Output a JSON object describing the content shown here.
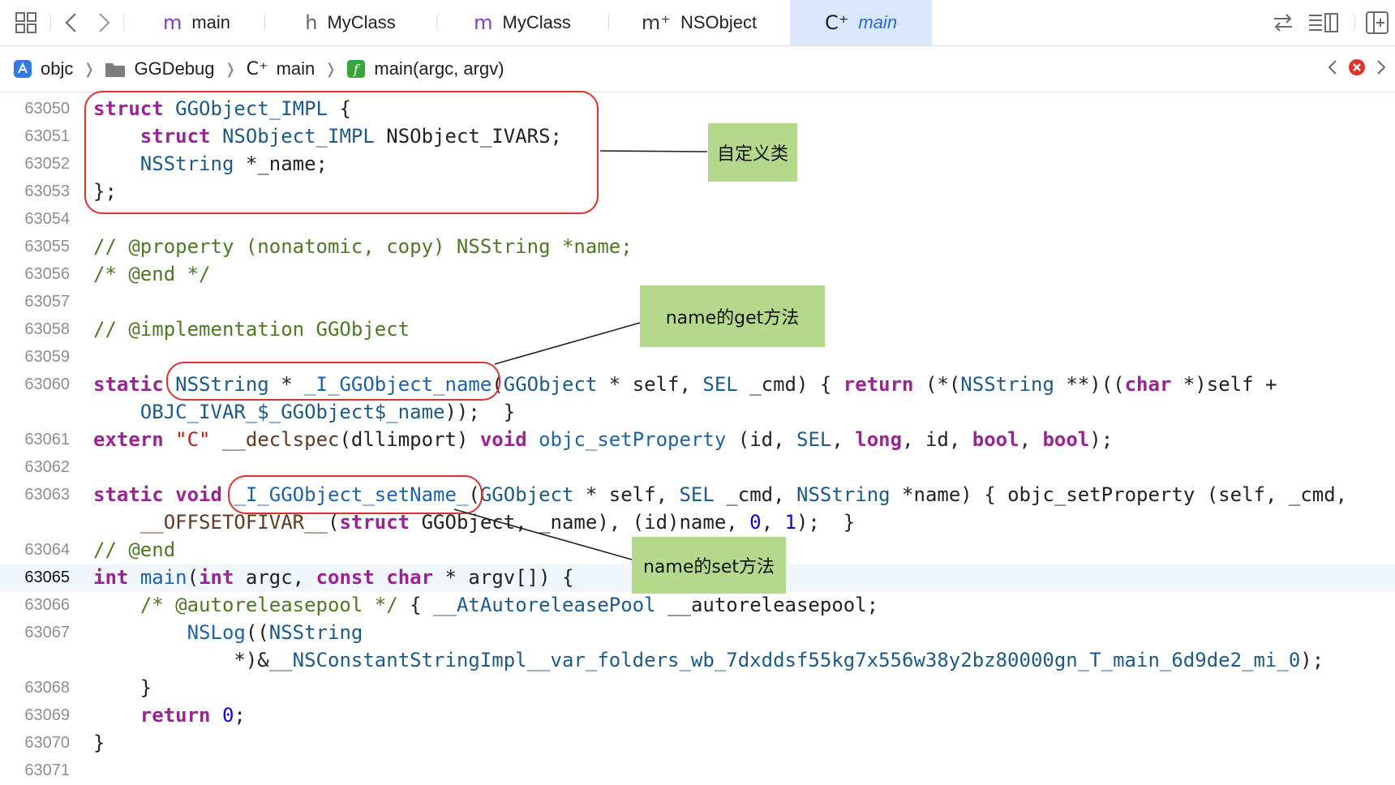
{
  "tabs": [
    {
      "glyph": "m",
      "label": "main"
    },
    {
      "glyph": "h",
      "label": "MyClass"
    },
    {
      "glyph": "m",
      "label": "MyClass"
    },
    {
      "glyph": "m⁺",
      "label": "NSObject"
    },
    {
      "glyph": "C⁺",
      "label": "main",
      "active": true
    }
  ],
  "breadcrumb": {
    "items": [
      {
        "label": "objc",
        "icon": "xcode-project-icon"
      },
      {
        "label": "GGDebug",
        "icon": "folder-icon"
      },
      {
        "label": "main",
        "icon": "cpp-file-icon",
        "glyph": "C⁺"
      },
      {
        "label": "main(argc, argv)",
        "icon": "function-icon",
        "glyph": "f"
      }
    ],
    "separator": "❭"
  },
  "editor": {
    "current_line": "63065",
    "lines": [
      {
        "n": "63050"
      },
      {
        "n": "63051"
      },
      {
        "n": "63052"
      },
      {
        "n": "63053"
      },
      {
        "n": "63054"
      },
      {
        "n": "63055"
      },
      {
        "n": "63056"
      },
      {
        "n": "63057"
      },
      {
        "n": "63058"
      },
      {
        "n": "63059"
      },
      {
        "n": "63060"
      },
      {
        "n": ""
      },
      {
        "n": "63061"
      },
      {
        "n": "63062"
      },
      {
        "n": "63063"
      },
      {
        "n": ""
      },
      {
        "n": "63064"
      },
      {
        "n": "63065"
      },
      {
        "n": "63066"
      },
      {
        "n": "63067"
      },
      {
        "n": ""
      },
      {
        "n": "63068"
      },
      {
        "n": "63069"
      },
      {
        "n": "63070"
      },
      {
        "n": "63071"
      }
    ],
    "code": [
      [
        [
          "kw",
          "struct"
        ],
        [
          "pl",
          " "
        ],
        [
          "ty",
          "GGObject_IMPL"
        ],
        [
          "pl",
          " {"
        ]
      ],
      [
        [
          "pl",
          "    "
        ],
        [
          "kw",
          "struct"
        ],
        [
          "pl",
          " "
        ],
        [
          "ty",
          "NSObject_IMPL"
        ],
        [
          "pl",
          " NSObject_IVARS;"
        ]
      ],
      [
        [
          "pl",
          "    "
        ],
        [
          "ty",
          "NSString"
        ],
        [
          "pl",
          " *_name;"
        ]
      ],
      [
        [
          "pl",
          "};"
        ]
      ],
      [],
      [
        [
          "cm",
          "// @property (nonatomic, copy) NSString *name;"
        ]
      ],
      [
        [
          "cm",
          "/* @end */"
        ]
      ],
      [],
      [
        [
          "cm",
          "// @implementation GGObject"
        ]
      ],
      [],
      [
        [
          "kw",
          "static"
        ],
        [
          "pl",
          " "
        ],
        [
          "ty",
          "NSString"
        ],
        [
          "pl",
          " * "
        ],
        [
          "fn",
          "_I_GGObject_name"
        ],
        [
          "pl",
          "("
        ],
        [
          "ty",
          "GGObject"
        ],
        [
          "pl",
          " * self, "
        ],
        [
          "ty",
          "SEL"
        ],
        [
          "pl",
          " _cmd) { "
        ],
        [
          "kw",
          "return"
        ],
        [
          "pl",
          " (*("
        ],
        [
          "ty",
          "NSString"
        ],
        [
          "pl",
          " **)(("
        ],
        [
          "kw",
          "char"
        ],
        [
          "pl",
          " *)self +"
        ]
      ],
      [
        [
          "pl",
          "    "
        ],
        [
          "ty",
          "OBJC_IVAR_$_GGObject$_name"
        ],
        [
          "pl",
          "));  }"
        ]
      ],
      [
        [
          "kw",
          "extern"
        ],
        [
          "pl",
          " "
        ],
        [
          "st",
          "\"C\""
        ],
        [
          "pl",
          " "
        ],
        [
          "mc",
          "__declspec"
        ],
        [
          "pl",
          "(dllimport) "
        ],
        [
          "kw",
          "void"
        ],
        [
          "pl",
          " "
        ],
        [
          "fn",
          "objc_setProperty"
        ],
        [
          "pl",
          " (id, "
        ],
        [
          "ty",
          "SEL"
        ],
        [
          "pl",
          ", "
        ],
        [
          "kw",
          "long"
        ],
        [
          "pl",
          ", id, "
        ],
        [
          "kw",
          "bool"
        ],
        [
          "pl",
          ", "
        ],
        [
          "kw",
          "bool"
        ],
        [
          "pl",
          ");"
        ]
      ],
      [],
      [
        [
          "kw",
          "static"
        ],
        [
          "pl",
          " "
        ],
        [
          "kw",
          "void"
        ],
        [
          "pl",
          " "
        ],
        [
          "fn",
          "_I_GGObject_setName_"
        ],
        [
          "pl",
          "("
        ],
        [
          "ty",
          "GGObject"
        ],
        [
          "pl",
          " * self, "
        ],
        [
          "ty",
          "SEL"
        ],
        [
          "pl",
          " _cmd, "
        ],
        [
          "ty",
          "NSString"
        ],
        [
          "pl",
          " *name) { objc_setProperty (self, _cmd,"
        ]
      ],
      [
        [
          "pl",
          "    "
        ],
        [
          "mc",
          "__OFFSETOFIVAR__"
        ],
        [
          "pl",
          "("
        ],
        [
          "kw",
          "struct"
        ],
        [
          "pl",
          " GGObject, _name), (id)name, "
        ],
        [
          "nm",
          "0"
        ],
        [
          "pl",
          ", "
        ],
        [
          "nm",
          "1"
        ],
        [
          "pl",
          ");  }"
        ]
      ],
      [
        [
          "cm",
          "// @end"
        ]
      ],
      [
        [
          "kw",
          "int"
        ],
        [
          "pl",
          " "
        ],
        [
          "fn",
          "main"
        ],
        [
          "pl",
          "("
        ],
        [
          "kw",
          "int"
        ],
        [
          "pl",
          " argc, "
        ],
        [
          "kw",
          "const"
        ],
        [
          "pl",
          " "
        ],
        [
          "kw",
          "char"
        ],
        [
          "pl",
          " * argv[]) {"
        ]
      ],
      [
        [
          "pl",
          "    "
        ],
        [
          "cm",
          "/* @autoreleasepool */"
        ],
        [
          "pl",
          " { "
        ],
        [
          "ty",
          "__AtAutoreleasePool"
        ],
        [
          "pl",
          " __autoreleasepool;"
        ]
      ],
      [
        [
          "pl",
          "        "
        ],
        [
          "fn",
          "NSLog"
        ],
        [
          "pl",
          "(("
        ],
        [
          "ty",
          "NSString"
        ]
      ],
      [
        [
          "pl",
          "            *)&"
        ],
        [
          "ty",
          "__NSConstantStringImpl__var_folders_wb_7dxddsf55kg7x556w38y2bz80000gn_T_main_6d9de2_mi_0"
        ],
        [
          "pl",
          ");"
        ]
      ],
      [
        [
          "pl",
          "    }"
        ]
      ],
      [
        [
          "pl",
          "    "
        ],
        [
          "kw",
          "return"
        ],
        [
          "pl",
          " "
        ],
        [
          "nm",
          "0"
        ],
        [
          "pl",
          ";"
        ]
      ],
      [
        [
          "pl",
          "}"
        ]
      ],
      []
    ]
  },
  "annotations": {
    "custom_class": "自定义类",
    "getter": "name的get方法",
    "setter": "name的set方法"
  },
  "colors": {
    "keyword": "#9b2393",
    "type": "#1c5b87",
    "comment": "#4c7a24",
    "string": "#c41a16",
    "number": "#1c00cf",
    "highlight_box": "#e03030",
    "note_bg": "#b5d98c",
    "active_tab": "#d9e6fb"
  }
}
